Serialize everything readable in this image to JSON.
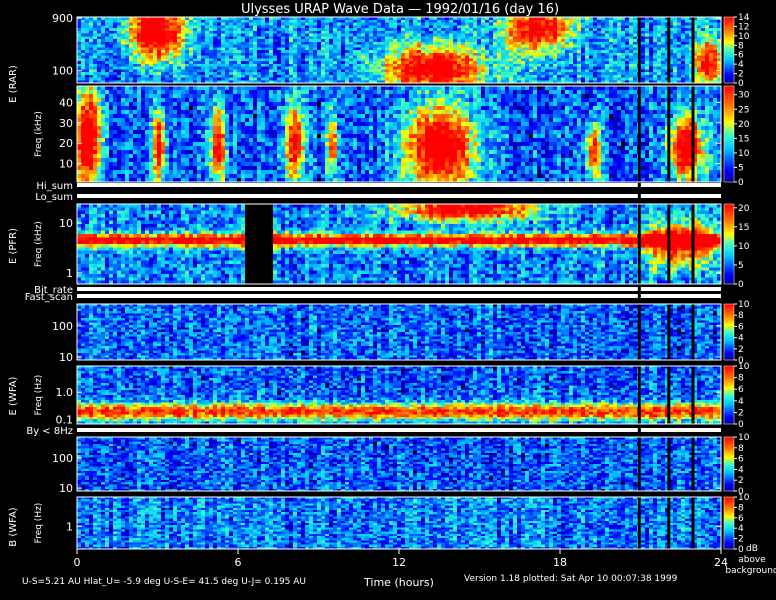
{
  "chart_data": {
    "type": "heatmap",
    "title": "Ulysses URAP Wave Data — 1992/01/16  (day 16)",
    "xlabel": "Time (hours)",
    "xlim": [
      0,
      24
    ],
    "x_ticks": [
      0,
      6,
      12,
      18,
      24
    ],
    "panels": [
      {
        "id": "rar-high",
        "group_label": "E (RAR)",
        "ylabel": "",
        "ylim": [
          60,
          940
        ],
        "scale": "log",
        "y_ticks": [
          {
            "v": 900,
            "l": "900"
          },
          {
            "v": 100,
            "l": "100"
          }
        ],
        "colorbar_ticks": [
          14,
          12,
          10,
          8,
          6,
          4,
          2,
          0
        ],
        "colorbar_max": 14,
        "seed": 3,
        "blobs": [
          [
            2.9,
            0.8,
            1.0,
            0.45,
            1.0
          ],
          [
            13.3,
            0.2,
            1.8,
            0.35,
            0.9
          ],
          [
            17.2,
            0.85,
            1.2,
            0.35,
            0.8
          ],
          [
            23.6,
            0.3,
            0.5,
            0.35,
            0.8
          ]
        ],
        "baseline": 0.4
      },
      {
        "id": "rar-low",
        "group_label": "",
        "ylabel": "Freq (kHz)",
        "ylim": [
          1,
          48
        ],
        "scale": "linear",
        "y_ticks": [
          {
            "v": 40,
            "l": "40"
          },
          {
            "v": 30,
            "l": "30"
          },
          {
            "v": 20,
            "l": "20"
          },
          {
            "v": 10,
            "l": "10"
          }
        ],
        "colorbar_ticks": [
          30,
          25,
          20,
          15,
          10,
          5,
          0
        ],
        "colorbar_max": 33,
        "seed": 7,
        "blobs": [
          [
            0.3,
            0.45,
            0.5,
            0.55,
            1.0
          ],
          [
            3.0,
            0.35,
            0.25,
            0.4,
            0.8
          ],
          [
            5.2,
            0.4,
            0.3,
            0.4,
            0.8
          ],
          [
            8.1,
            0.4,
            0.35,
            0.45,
            0.85
          ],
          [
            9.5,
            0.4,
            0.2,
            0.35,
            0.7
          ],
          [
            13.5,
            0.35,
            1.3,
            0.45,
            1.0
          ],
          [
            19.3,
            0.3,
            0.3,
            0.3,
            0.7
          ],
          [
            22.8,
            0.35,
            0.6,
            0.35,
            1.0
          ]
        ],
        "baseline": 0.3
      },
      {
        "id": "pfr",
        "group_label": "E (PFR)",
        "ylabel": "Freq (kHz)",
        "ylim": [
          0.6,
          24
        ],
        "scale": "log",
        "y_ticks": [
          {
            "v": 10,
            "l": "10"
          },
          {
            "v": 1,
            "l": "1"
          }
        ],
        "colorbar_ticks": [
          20,
          15,
          10,
          5,
          0
        ],
        "colorbar_max": 21,
        "seed": 11,
        "blobs": [
          [
            14.5,
            0.95,
            2.5,
            0.15,
            0.9
          ],
          [
            22.5,
            0.5,
            1.2,
            0.3,
            0.8
          ]
        ],
        "band": [
          0.55,
          0.08,
          0.85
        ],
        "gap": [
          6.2,
          7.3
        ],
        "baseline": 0.35
      },
      {
        "id": "wfa-e-high",
        "group_label": "E (WFA)",
        "ylabel": "",
        "ylim": [
          8,
          500
        ],
        "scale": "log",
        "y_ticks": [
          {
            "v": 100,
            "l": "100"
          },
          {
            "v": 10,
            "l": "10"
          }
        ],
        "colorbar_ticks": [
          10,
          8,
          6,
          4,
          2,
          0
        ],
        "colorbar_max": 10,
        "seed": 17,
        "blobs": [],
        "baseline": 0.3
      },
      {
        "id": "wfa-e-low",
        "group_label": "",
        "ylabel": "Freq (Hz)",
        "ylim": [
          0.07,
          9
        ],
        "scale": "log",
        "y_ticks": [
          {
            "v": 1,
            "l": "1.0"
          },
          {
            "v": 0.1,
            "l": "0.1"
          }
        ],
        "colorbar_ticks": [
          10,
          8,
          6,
          4,
          2,
          0
        ],
        "colorbar_max": 10,
        "seed": 23,
        "blobs": [],
        "band": [
          0.2,
          0.15,
          0.7
        ],
        "baseline": 0.3
      },
      {
        "id": "wfa-b-high",
        "group_label": "B (WFA)",
        "ylabel": "",
        "ylim": [
          8,
          500
        ],
        "scale": "log",
        "y_ticks": [
          {
            "v": 100,
            "l": "100"
          },
          {
            "v": 10,
            "l": "10"
          }
        ],
        "colorbar_ticks": [
          10,
          8,
          6,
          4,
          2,
          0
        ],
        "colorbar_max": 10,
        "seed": 29,
        "blobs": [],
        "baseline": 0.3
      },
      {
        "id": "wfa-b-low",
        "group_label": "",
        "ylabel": "Freq (Hz)",
        "ylim": [
          0.2,
          8
        ],
        "scale": "log",
        "y_ticks": [
          {
            "v": 1,
            "l": "1"
          }
        ],
        "colorbar_ticks": [
          10,
          8,
          6,
          4,
          2,
          0
        ],
        "colorbar_max": 10,
        "seed": 31,
        "blobs": [],
        "baseline": 0.35
      }
    ],
    "status_strips": [
      "Hi_sum",
      "Lo_sum",
      "Bit_rate",
      "Fast_scan",
      "By < 8Hz"
    ],
    "colorbar_unit": [
      "dB",
      "above",
      "background"
    ]
  },
  "footer": {
    "left": "U-S=5.21 AU  Hlat_U= -5.9 deg  U-S-E= 41.5 deg  U-J= 0.195 AU",
    "right": "Version 1.18 plotted: Sat Apr 10 00:07:38 1999"
  },
  "colors": {
    "background": "#000000",
    "text": "#ffffff"
  }
}
